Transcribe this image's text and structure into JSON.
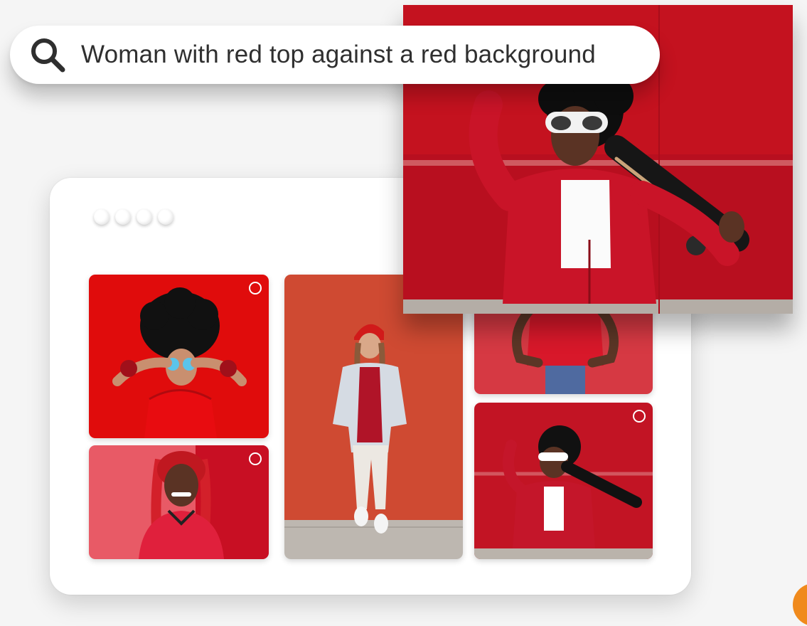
{
  "search": {
    "query": "Woman with red top against a red background",
    "icon": "search-icon"
  },
  "window": {
    "dot_count": 4
  },
  "results": [
    {
      "id": "tile-1",
      "selected": false
    },
    {
      "id": "tile-2",
      "selected": false
    },
    {
      "id": "tile-3",
      "selected": false
    },
    {
      "id": "tile-4",
      "selected": false
    },
    {
      "id": "tile-5",
      "selected": false
    }
  ],
  "colors": {
    "primary_red": "#c8102e",
    "accent_orange": "#f08a1c",
    "background": "#f5f5f5",
    "card": "#ffffff"
  }
}
